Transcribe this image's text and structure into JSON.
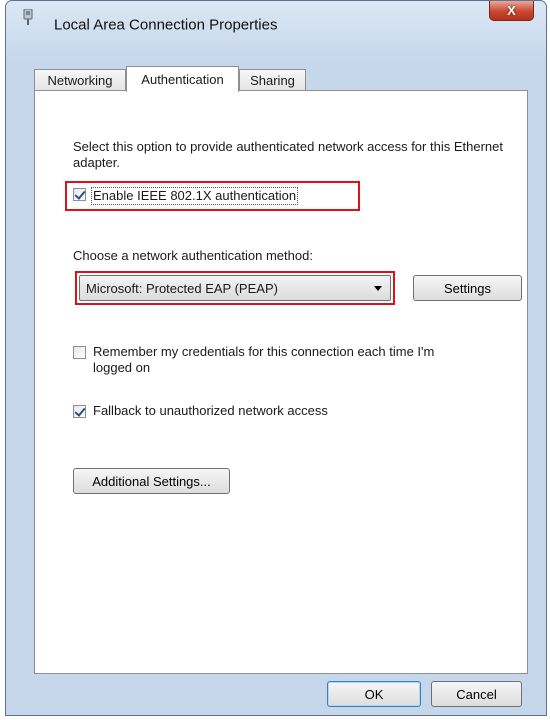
{
  "window": {
    "title": "Local Area Connection Properties",
    "close_label": "X"
  },
  "tabs": [
    {
      "label": "Networking"
    },
    {
      "label": "Authentication"
    },
    {
      "label": "Sharing"
    }
  ],
  "authentication": {
    "description": "Select this option to provide authenticated network access for this Ethernet adapter.",
    "enable_8021x": {
      "label": "Enable IEEE 802.1X authentication",
      "checked": true
    },
    "method_label": "Choose a network authentication method:",
    "method_selected": "Microsoft: Protected EAP (PEAP)",
    "settings_label": "Settings",
    "remember_credentials": {
      "label": "Remember my credentials for this connection each time I'm logged on",
      "checked": false
    },
    "fallback": {
      "label": "Fallback to unauthorized network access",
      "checked": true
    },
    "additional_settings_label": "Additional Settings..."
  },
  "footer": {
    "ok_label": "OK",
    "cancel_label": "Cancel"
  },
  "colors": {
    "highlight": "#e0101b",
    "titlebar": "#dbe7f4",
    "close_button": "#c9472f"
  }
}
